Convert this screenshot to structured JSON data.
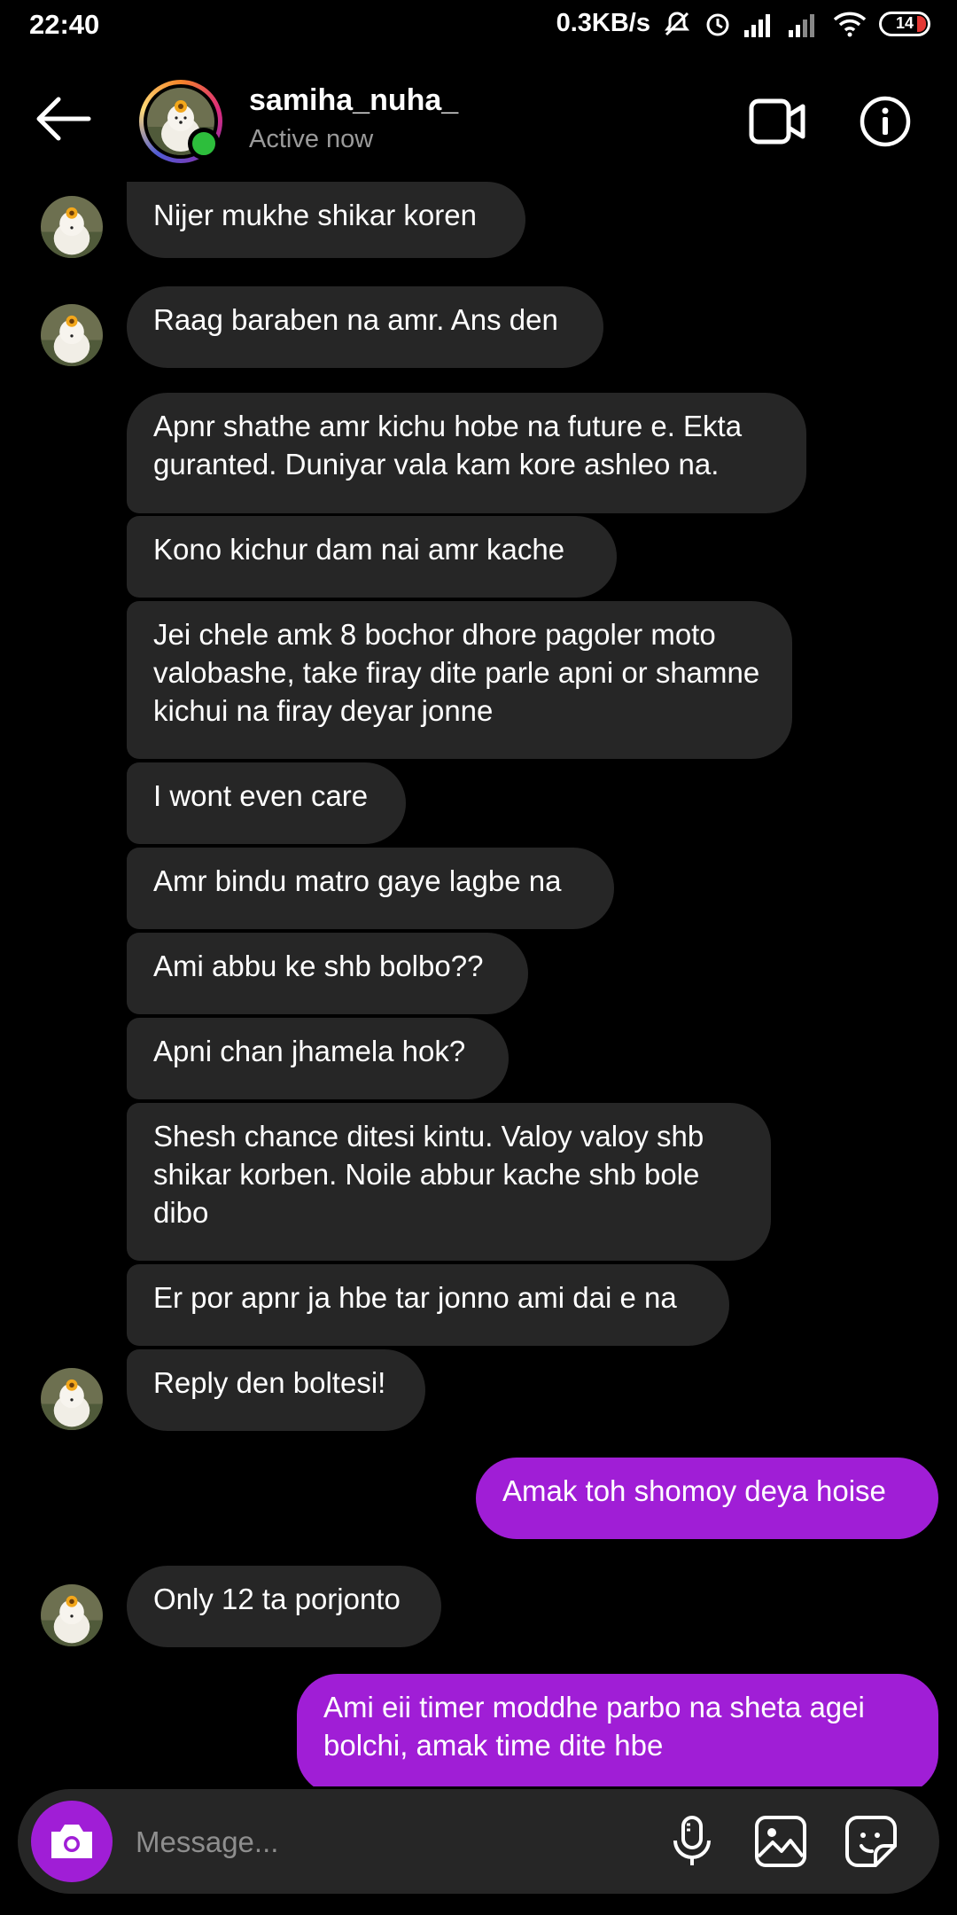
{
  "status_bar": {
    "time": "22:40",
    "net_speed": "0.3KB/s",
    "battery": "14"
  },
  "header": {
    "username": "samiha_nuha_",
    "status": "Active now",
    "icons": [
      "back-arrow-icon",
      "video-call-icon",
      "info-icon"
    ]
  },
  "messages": [
    {
      "dir": "in",
      "text": "Nijer mukhe shikar koren"
    },
    {
      "dir": "in",
      "text": "Raag baraben na amr. Ans den"
    },
    {
      "dir": "in",
      "text": "Apnr shathe amr kichu hobe na future e. Ekta guranted. Duniyar vala kam kore ashleo na."
    },
    {
      "dir": "in",
      "text": "Kono kichur dam nai amr kache"
    },
    {
      "dir": "in",
      "text": "Jei chele amk 8 bochor dhore pagoler moto valobashe, take firay dite parle apni or shamne kichui na firay deyar jonne"
    },
    {
      "dir": "in",
      "text": "I wont even care"
    },
    {
      "dir": "in",
      "text": "Amr bindu matro gaye lagbe na"
    },
    {
      "dir": "in",
      "text": "Ami abbu ke shb bolbo??"
    },
    {
      "dir": "in",
      "text": "Apni chan jhamela hok?"
    },
    {
      "dir": "in",
      "text": "Shesh chance ditesi kintu. Valoy valoy shb shikar korben. Noile abbur kache shb bole dibo"
    },
    {
      "dir": "in",
      "text": "Er por apnr ja hbe tar jonno ami dai e na"
    },
    {
      "dir": "in",
      "text": "Reply den boltesi!"
    },
    {
      "dir": "out",
      "text": "Amak toh shomoy deya hoise"
    },
    {
      "dir": "in",
      "text": "Only 12 ta porjonto"
    },
    {
      "dir": "out",
      "text": "Ami eii timer moddhe parbo na sheta agei bolchi, amak time dite hbe"
    }
  ],
  "composer": {
    "placeholder": "Message...",
    "icons": [
      "camera-icon",
      "microphone-icon",
      "gallery-icon",
      "sticker-icon"
    ]
  },
  "colors": {
    "background": "#000000",
    "incoming_bubble": "#262626",
    "outgoing_bubble": "#a01ed6",
    "online": "#2dbe3c"
  }
}
